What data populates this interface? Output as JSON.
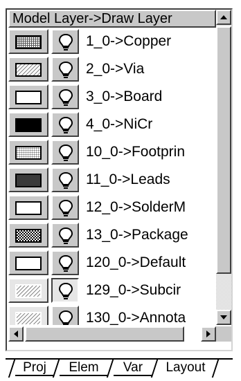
{
  "header": {
    "title": "Model Layer->Draw Layer"
  },
  "layers": [
    {
      "label": "1_0->Copper",
      "swatch": "grid"
    },
    {
      "label": "2_0->Via",
      "swatch": "diag"
    },
    {
      "label": "3_0->Board",
      "swatch": "white"
    },
    {
      "label": "4_0->NiCr",
      "swatch": "black"
    },
    {
      "label": "10_0->Footprin",
      "swatch": "fine"
    },
    {
      "label": "11_0->Leads",
      "swatch": "dark"
    },
    {
      "label": "12_0->SolderM",
      "swatch": "white"
    },
    {
      "label": "13_0->Package",
      "swatch": "check"
    },
    {
      "label": "120_0->Default",
      "swatch": "white"
    },
    {
      "label": "129_0->Subcir",
      "swatch": "diag"
    },
    {
      "label": "130_0->Annota",
      "swatch": "diag"
    }
  ],
  "tabs": [
    "Proj",
    "Elem",
    "Var",
    "Layout"
  ],
  "active_tab": "Layout",
  "icons": {
    "visibility": "lightbulb-icon",
    "scroll_up": "arrow-up-icon",
    "scroll_down": "arrow-down-icon",
    "scroll_left": "arrow-left-icon",
    "scroll_right": "arrow-right-icon"
  }
}
